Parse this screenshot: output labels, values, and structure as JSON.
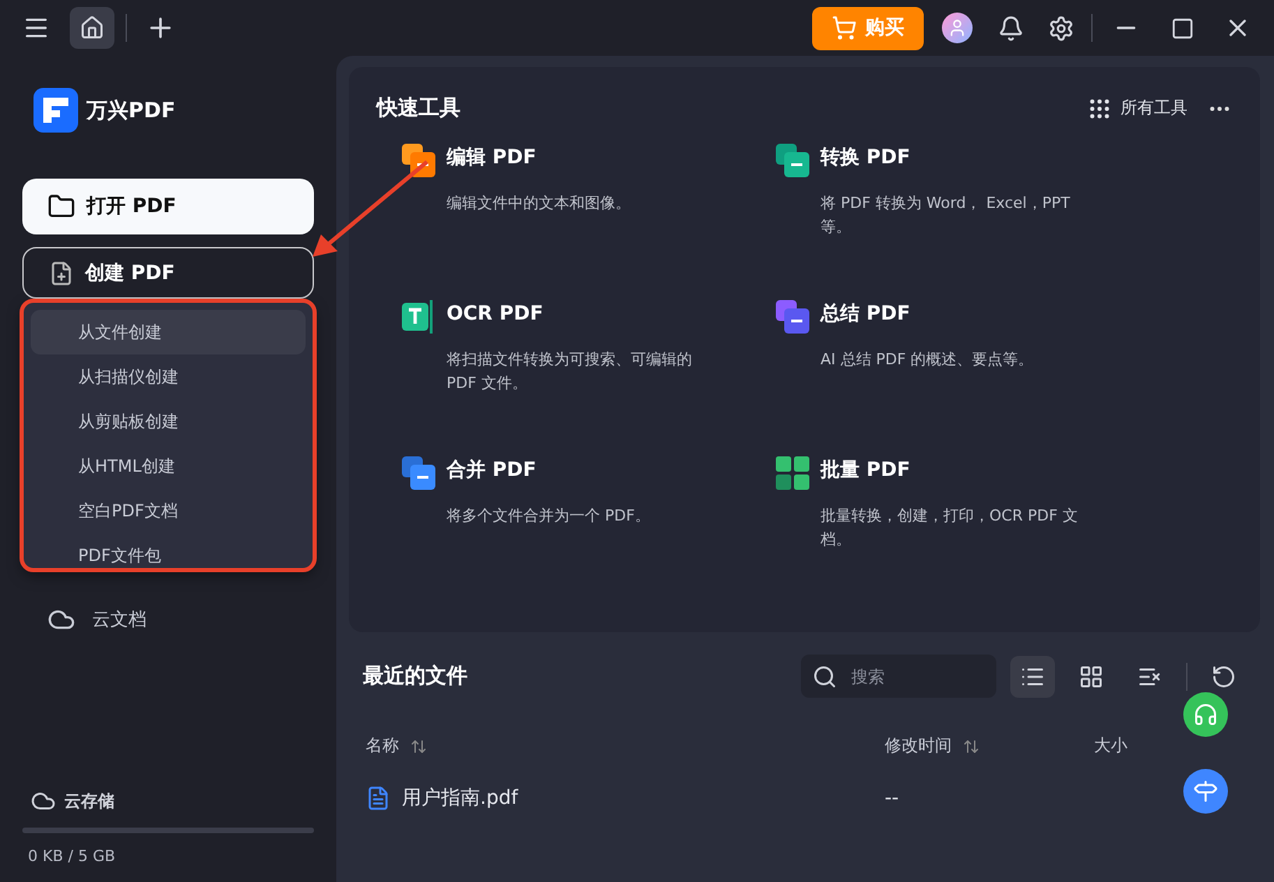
{
  "topbar": {
    "buy_label": "购买"
  },
  "sidebar": {
    "logo": "万兴PDF",
    "open_button": "打开 PDF",
    "create_button": "创建 PDF",
    "create_menu": [
      {
        "label": "从文件创建",
        "selected": true
      },
      {
        "label": "从扫描仪创建",
        "selected": false
      },
      {
        "label": "从剪贴板创建",
        "selected": false
      },
      {
        "label": "从HTML创建",
        "selected": false
      },
      {
        "label": "空白PDF文档",
        "selected": false
      },
      {
        "label": "PDF文件包",
        "selected": false
      }
    ],
    "cloud_docs": "云文档",
    "storage": {
      "label": "云存储",
      "level": 0,
      "usage": "0 KB / 5 GB"
    }
  },
  "quick_tools": {
    "title": "快速工具",
    "all_tools": "所有工具",
    "tools": [
      {
        "kind": "edit",
        "title": "编辑 PDF",
        "description": "编辑文件中的文本和图像。"
      },
      {
        "kind": "convert",
        "title": "转换 PDF",
        "description": "将 PDF 转换为 Word， Excel，PPT 等。"
      },
      {
        "kind": "ocr",
        "title": "OCR PDF",
        "description": "将扫描文件转换为可搜索、可编辑的 PDF 文件。"
      },
      {
        "kind": "summary",
        "title": "总结 PDF",
        "description": "AI 总结 PDF 的概述、要点等。"
      },
      {
        "kind": "merge",
        "title": "合并 PDF",
        "description": "将多个文件合并为一个 PDF。"
      },
      {
        "kind": "batch",
        "title": "批量 PDF",
        "description": "批量转换，创建，打印，OCR PDF 文档。"
      }
    ]
  },
  "recent_files": {
    "title": "最近的文件",
    "search": {
      "placeholder": "搜索"
    },
    "views": [
      {
        "kind": "list",
        "selected": true
      },
      {
        "kind": "grid",
        "selected": false
      }
    ],
    "columns": [
      "名称",
      "修改时间",
      "大小"
    ],
    "rows": [
      {
        "name": "用户指南.pdf",
        "modified": "--"
      }
    ]
  }
}
